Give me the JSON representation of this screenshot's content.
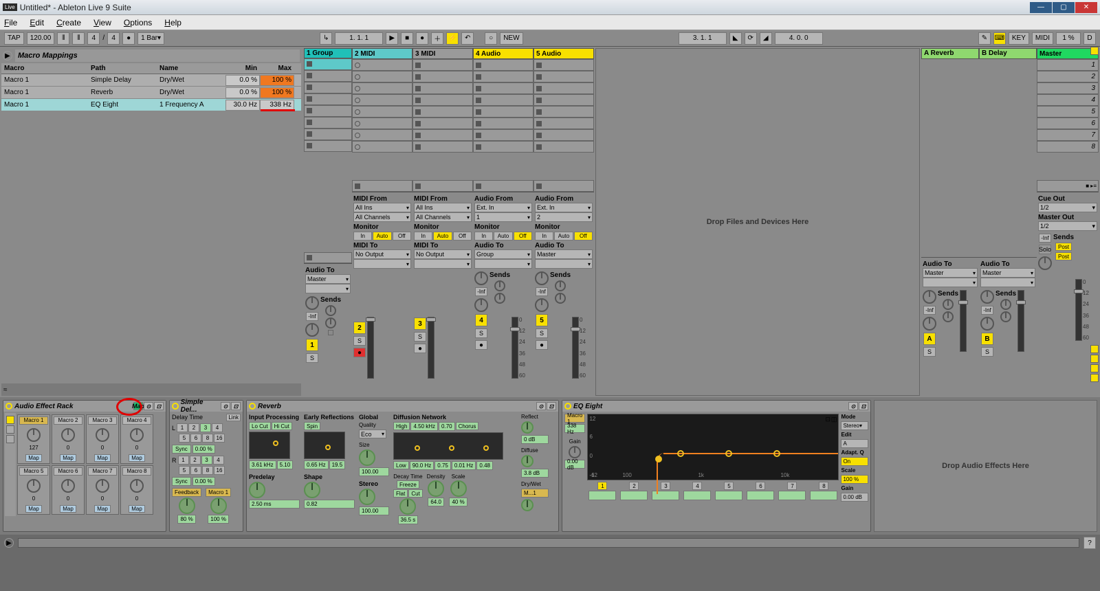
{
  "window": {
    "title": "Untitled* - Ableton Live 9 Suite"
  },
  "menu": {
    "file": "File",
    "edit": "Edit",
    "create": "Create",
    "view": "View",
    "options": "Options",
    "help": "Help"
  },
  "transport": {
    "tap": "TAP",
    "tempo": "120.00",
    "sig_num": "4",
    "sig_den": "4",
    "quant": "1 Bar",
    "position": "1.  1.  1",
    "loop_pos": "3.  1.  1",
    "loop_len": "4.  0.  0",
    "new": "NEW",
    "key": "KEY",
    "midi": "MIDI",
    "cpu": "1 %",
    "d": "D"
  },
  "macro_panel": {
    "title": "Macro Mappings",
    "headers": {
      "macro": "Macro",
      "path": "Path",
      "name": "Name",
      "min": "Min",
      "max": "Max"
    },
    "rows": [
      {
        "macro": "Macro 1",
        "path": "Simple Delay",
        "name": "Dry/Wet",
        "min": "0.0 %",
        "max": "100 %",
        "max_cls": "orange"
      },
      {
        "macro": "Macro 1",
        "path": "Reverb",
        "name": "Dry/Wet",
        "min": "0.0 %",
        "max": "100 %",
        "max_cls": "orange"
      },
      {
        "macro": "Macro 1",
        "path": "EQ Eight",
        "name": "1 Frequency A",
        "min": "30.0 Hz",
        "max": "338 Hz",
        "max_cls": "",
        "sel": true,
        "underline": true
      }
    ]
  },
  "tracks": [
    {
      "name": "1 Group",
      "cls": "hdr-teal",
      "num": "1",
      "width": "group",
      "slot": "stop",
      "audio_to": "Master",
      "armed": false,
      "has_midi_from": false,
      "has_audio_from": false
    },
    {
      "name": "2 MIDI",
      "cls": "hdr-cyan",
      "num": "2",
      "slot": "circle",
      "midi_from": "All Ins",
      "midi_ch": "All Channels",
      "midi_to": "No Output",
      "mon": "Auto",
      "armed": true
    },
    {
      "name": "3 MIDI",
      "cls": "hdr-grey",
      "num": "3",
      "slot": "stop",
      "midi_from": "All Ins",
      "midi_ch": "All Channels",
      "midi_to": "No Output",
      "mon": "Auto"
    },
    {
      "name": "4 Audio",
      "cls": "hdr-yellow",
      "num": "4",
      "slot": "stop",
      "audio_from": "Ext. In",
      "audio_ch": "1",
      "audio_to": "Group",
      "mon": "Off"
    },
    {
      "name": "5 Audio",
      "cls": "hdr-yellow",
      "num": "5",
      "slot": "stop",
      "audio_from": "Ext. In",
      "audio_ch": "2",
      "audio_to": "Master",
      "mon": "Off"
    }
  ],
  "drop_msg": "Drop Files and Devices Here",
  "returns": [
    {
      "name": "A Reverb",
      "cls": "hdr-lime",
      "btn": "A",
      "audio_to": "Master"
    },
    {
      "name": "B Delay",
      "cls": "hdr-lime",
      "btn": "B",
      "audio_to": "Master"
    }
  ],
  "master": {
    "name": "Master",
    "cue": "Cue Out",
    "cue_ch": "1/2",
    "master_out": "Master Out",
    "master_ch": "1/2",
    "post": "Post",
    "solo": "Solo"
  },
  "scenes": [
    "1",
    "2",
    "3",
    "4",
    "5",
    "6",
    "7",
    "8"
  ],
  "io_labels": {
    "midi_from": "MIDI From",
    "midi_to": "MIDI To",
    "audio_from": "Audio From",
    "audio_to": "Audio To",
    "monitor": "Monitor",
    "sends": "Sends",
    "inf": "-Inf"
  },
  "monitor_opts": {
    "in": "In",
    "auto": "Auto",
    "off": "Off"
  },
  "meter_ticks": [
    "0",
    "12",
    "24",
    "36",
    "48",
    "60"
  ],
  "devices": {
    "rack": {
      "title": "Audio Effect Rack",
      "map": "Map",
      "macros": [
        {
          "lbl": "Macro 1",
          "val": "127",
          "map": "Map",
          "active": true
        },
        {
          "lbl": "Macro 2",
          "val": "0",
          "map": "Map"
        },
        {
          "lbl": "Macro 3",
          "val": "0",
          "map": "Map"
        },
        {
          "lbl": "Macro 4",
          "val": "0",
          "map": "Map"
        },
        {
          "lbl": "Macro 5",
          "val": "0",
          "map": "Map"
        },
        {
          "lbl": "Macro 6",
          "val": "0",
          "map": "Map"
        },
        {
          "lbl": "Macro 7",
          "val": "0",
          "map": "Map"
        },
        {
          "lbl": "Macro 8",
          "val": "0",
          "map": "Map"
        }
      ]
    },
    "delay": {
      "title": "Simple Del...",
      "delay_time": "Delay Time",
      "link": "Link",
      "l": "L",
      "r": "R",
      "sync": "Sync",
      "offset": "0.00 %",
      "feedback": "Feedback",
      "fb_val": "80 %",
      "macro1": "Macro 1",
      "macro1_val": "100 %",
      "beats": [
        "1",
        "2",
        "3",
        "4",
        "5",
        "6",
        "8",
        "16"
      ]
    },
    "reverb": {
      "title": "Reverb",
      "input": "Input Processing",
      "locut": "Lo Cut",
      "hicut": "Hi Cut",
      "spin": "Spin",
      "in_freq": "3.61 kHz",
      "in_w": "5.10",
      "early": "Early Reflections",
      "er_freq": "0.65 Hz",
      "er_amt": "19.5",
      "global": "Global",
      "quality": "Quality",
      "quality_val": "Eco",
      "size": "Size",
      "size_val": "100.00",
      "diffusion": "Diffusion Network",
      "high": "High",
      "dn_freq": "4.50 kHz",
      "dn_amt": "0.70",
      "chorus": "Chorus",
      "low": "Low",
      "low_freq": "90.0 Hz",
      "low_amt": "0.75",
      "low_dec": "0.01 Hz",
      "low_w": "0.48",
      "predelay": "Predelay",
      "predelay_val": "2.50 ms",
      "shape": "Shape",
      "shape_val": "0.82",
      "stereo": "Stereo",
      "stereo_val": "100.00",
      "decay": "Decay Time",
      "decay_val": "36.5 s",
      "freeze": "Freeze",
      "flat": "Flat",
      "cut": "Cut",
      "density": "Density",
      "density_val": "64.0",
      "scale": "Scale",
      "scale_val": "40 %",
      "reflect": "Reflect",
      "reflect_val": "0 dB",
      "diffuse": "Diffuse",
      "diffuse_val": "3.8 dB",
      "drywet": "Dry/Wet",
      "drywet_mapped": "M...1"
    },
    "eq": {
      "title": "EQ Eight",
      "macro1": "Macro 1",
      "macro1_val": "338 Hz",
      "gain": "Gain",
      "gain_val": "0.00 dB",
      "mode": "Mode",
      "mode_val": "Stereo",
      "edit": "Edit",
      "edit_val": "A",
      "adaptq": "Adapt. Q",
      "adaptq_val": "On",
      "scale": "Scale",
      "scale_val": "100 %",
      "gain2": "Gain",
      "gain2_val": "0.00 dB",
      "ticks": [
        "12",
        "6",
        "0",
        "-6",
        "-12"
      ],
      "freq_ticks": [
        "100",
        "1k",
        "10k"
      ]
    }
  },
  "drop_fx": "Drop Audio Effects Here"
}
